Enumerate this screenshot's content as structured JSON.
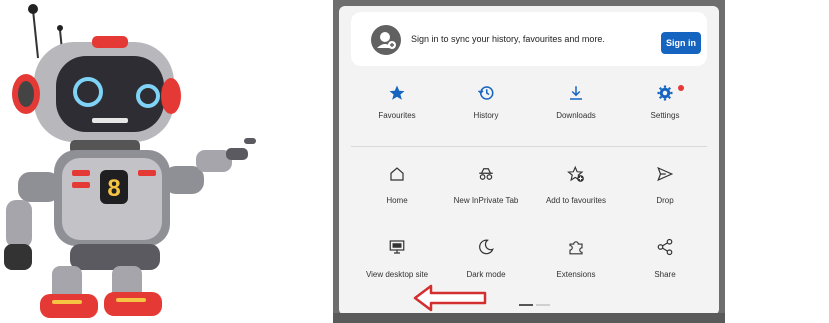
{
  "signin": {
    "text": "Sign in to sync your history, favourites and more.",
    "button_label": "Sign in"
  },
  "quick_row": [
    {
      "label": "Favourites",
      "icon": "star-icon"
    },
    {
      "label": "History",
      "icon": "history-icon"
    },
    {
      "label": "Downloads",
      "icon": "download-icon"
    },
    {
      "label": "Settings",
      "icon": "gear-icon"
    }
  ],
  "menu_row_2": [
    {
      "label": "Home",
      "icon": "home-icon"
    },
    {
      "label": "New InPrivate Tab",
      "icon": "inprivate-icon"
    },
    {
      "label": "Add to favourites",
      "icon": "add-favourite-icon"
    },
    {
      "label": "Drop",
      "icon": "send-icon"
    }
  ],
  "menu_row_3": [
    {
      "label": "View desktop site",
      "icon": "monitor-icon"
    },
    {
      "label": "Dark mode",
      "icon": "moon-icon"
    },
    {
      "label": "Extensions",
      "icon": "puzzle-icon"
    },
    {
      "label": "Share",
      "icon": "share-icon"
    }
  ],
  "robot": {
    "chest_label": "8"
  },
  "colors": {
    "accent": "#1565c0",
    "notification": "#e53935",
    "arrow": "#d32f2f"
  }
}
